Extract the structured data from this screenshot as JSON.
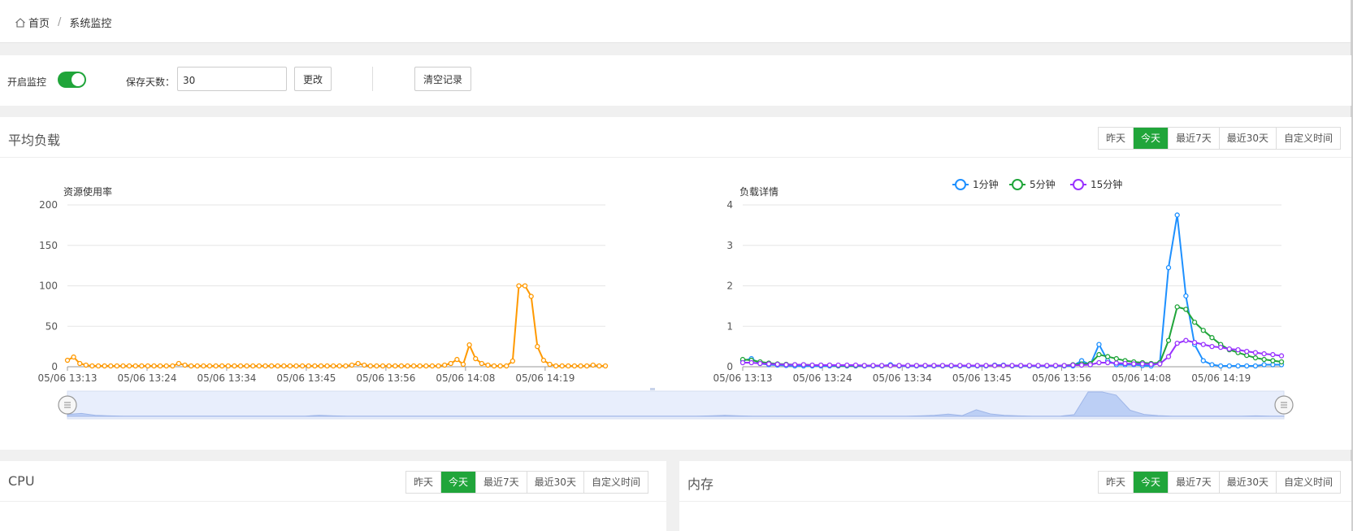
{
  "breadcrumb": {
    "home": "首页",
    "current": "系统监控",
    "separator": "/"
  },
  "controls": {
    "monitor_label": "开启监控",
    "monitor_enabled": true,
    "retention_label": "保存天数：",
    "retention_value": "30",
    "change_button": "更改",
    "clear_button": "清空记录"
  },
  "tabs": [
    "昨天",
    "今天",
    "最近7天",
    "最近30天",
    "自定义时间"
  ],
  "active_tab": "今天",
  "load_panel": {
    "title": "平均负载"
  },
  "cpu_panel": {
    "title": "CPU"
  },
  "memory_panel": {
    "title": "内存"
  },
  "colors": {
    "accent": "#20a53a",
    "orange": "#ff9900",
    "blue": "#1e90ff",
    "green": "#20a53a",
    "purple": "#9933ff"
  },
  "chart_data": [
    {
      "type": "line",
      "title": "资源使用率",
      "ylim": [
        0,
        200
      ],
      "yticks": [
        0,
        50,
        100,
        150,
        200
      ],
      "xticks": [
        "05/06 13:13",
        "05/06 13:24",
        "05/06 13:34",
        "05/06 13:45",
        "05/06 13:56",
        "05/06 14:08",
        "05/06 14:19"
      ],
      "series": [
        {
          "values": [
            8,
            12,
            4,
            2,
            1,
            1,
            1,
            1,
            1,
            1,
            1,
            1,
            1,
            1,
            1,
            1,
            1,
            1,
            4,
            2,
            1,
            1,
            1,
            1,
            1,
            1,
            1,
            1,
            1,
            1,
            1,
            1,
            1,
            1,
            1,
            1,
            1,
            1,
            1,
            1,
            1,
            1,
            1,
            1,
            1,
            1,
            2,
            4,
            2,
            1,
            1,
            1,
            1,
            1,
            1,
            1,
            1,
            1,
            1,
            1,
            1,
            2,
            4,
            9,
            3,
            27,
            10,
            4,
            2,
            1,
            1,
            1,
            7,
            100,
            100,
            87,
            25,
            8,
            3,
            1,
            1,
            1,
            1,
            1,
            1,
            2,
            1,
            1
          ]
        }
      ]
    },
    {
      "type": "line",
      "title": "负载详情",
      "ylim": [
        0,
        4
      ],
      "yticks": [
        0,
        1,
        2,
        3,
        4
      ],
      "xticks": [
        "05/06 13:13",
        "05/06 13:24",
        "05/06 13:34",
        "05/06 13:45",
        "05/06 13:56",
        "05/06 14:08",
        "05/06 14:19"
      ],
      "series": [
        {
          "name": "1分钟",
          "values": [
            0.15,
            0.2,
            0.08,
            0.05,
            0.04,
            0.03,
            0.02,
            0.02,
            0.02,
            0.02,
            0.02,
            0.02,
            0.02,
            0.02,
            0.02,
            0.02,
            0.02,
            0.05,
            0.02,
            0.02,
            0.02,
            0.02,
            0.02,
            0.02,
            0.02,
            0.02,
            0.02,
            0.02,
            0.02,
            0.04,
            0.04,
            0.02,
            0.02,
            0.02,
            0.02,
            0.02,
            0.02,
            0.02,
            0.02,
            0.15,
            0.05,
            0.55,
            0.15,
            0.05,
            0.05,
            0.05,
            0.03,
            0.02,
            0.1,
            2.45,
            3.75,
            1.75,
            0.55,
            0.15,
            0.05,
            0.02,
            0.02,
            0.02,
            0.02,
            0.02,
            0.05,
            0.05,
            0.05
          ]
        },
        {
          "name": "5分钟",
          "values": [
            0.18,
            0.16,
            0.12,
            0.09,
            0.07,
            0.06,
            0.05,
            0.05,
            0.04,
            0.04,
            0.04,
            0.03,
            0.03,
            0.03,
            0.03,
            0.03,
            0.03,
            0.03,
            0.03,
            0.03,
            0.03,
            0.03,
            0.03,
            0.03,
            0.03,
            0.03,
            0.03,
            0.03,
            0.03,
            0.03,
            0.03,
            0.03,
            0.03,
            0.03,
            0.03,
            0.03,
            0.03,
            0.03,
            0.05,
            0.07,
            0.08,
            0.3,
            0.25,
            0.2,
            0.15,
            0.12,
            0.1,
            0.08,
            0.1,
            0.65,
            1.48,
            1.42,
            1.1,
            0.9,
            0.72,
            0.55,
            0.42,
            0.35,
            0.28,
            0.22,
            0.18,
            0.15,
            0.12
          ]
        },
        {
          "name": "15分钟",
          "values": [
            0.1,
            0.1,
            0.08,
            0.07,
            0.06,
            0.05,
            0.05,
            0.05,
            0.04,
            0.04,
            0.04,
            0.04,
            0.04,
            0.04,
            0.03,
            0.03,
            0.03,
            0.03,
            0.03,
            0.03,
            0.03,
            0.03,
            0.03,
            0.03,
            0.03,
            0.03,
            0.03,
            0.03,
            0.03,
            0.03,
            0.03,
            0.03,
            0.03,
            0.03,
            0.03,
            0.03,
            0.03,
            0.03,
            0.04,
            0.04,
            0.05,
            0.1,
            0.1,
            0.09,
            0.08,
            0.07,
            0.07,
            0.06,
            0.07,
            0.25,
            0.58,
            0.65,
            0.6,
            0.55,
            0.5,
            0.48,
            0.44,
            0.42,
            0.38,
            0.35,
            0.32,
            0.3,
            0.27
          ]
        }
      ],
      "legend": "top"
    }
  ]
}
